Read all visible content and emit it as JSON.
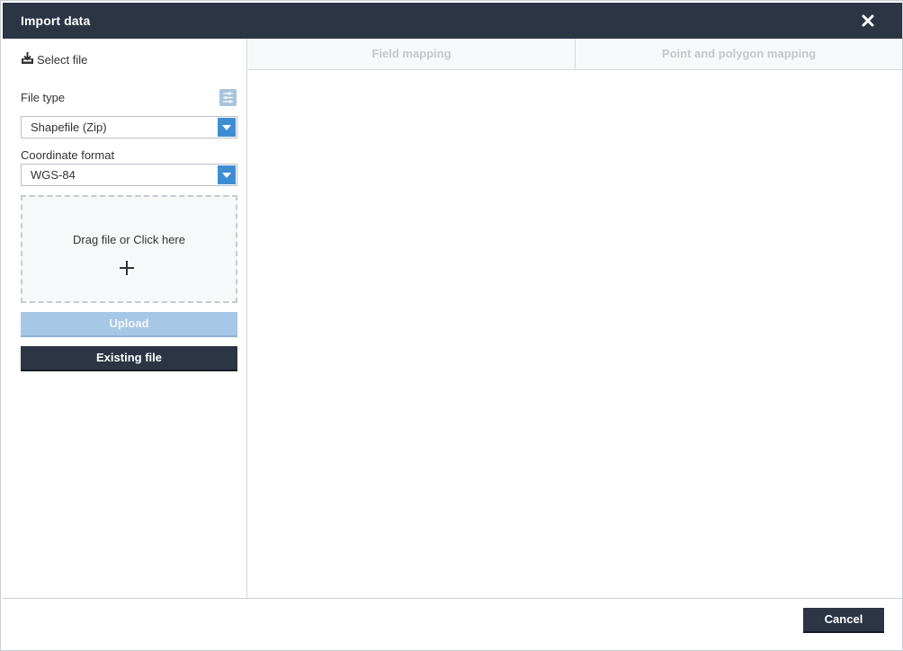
{
  "dialog": {
    "title": "Import data",
    "close_icon": "close-icon"
  },
  "sidebar": {
    "select_file_label": "Select file",
    "select_file_icon": "download-icon",
    "file_type_label": "File type",
    "file_type_value": "Shapefile (Zip)",
    "settings_icon": "sliders-icon",
    "coordinate_format_label": "Coordinate format",
    "coordinate_format_value": "WGS-84",
    "dropzone_text": "Drag file or Click here",
    "dropzone_icon": "plus-icon",
    "upload_label": "Upload",
    "existing_file_label": "Existing file"
  },
  "tabs": [
    {
      "label": "Field mapping"
    },
    {
      "label": "Point and polygon mapping"
    }
  ],
  "footer": {
    "cancel_label": "Cancel"
  },
  "colors": {
    "header_bg": "#2b3544",
    "accent_blue": "#3e8dd3",
    "upload_disabled": "#a7c7e6",
    "tab_text_disabled": "#c3c7cc"
  }
}
